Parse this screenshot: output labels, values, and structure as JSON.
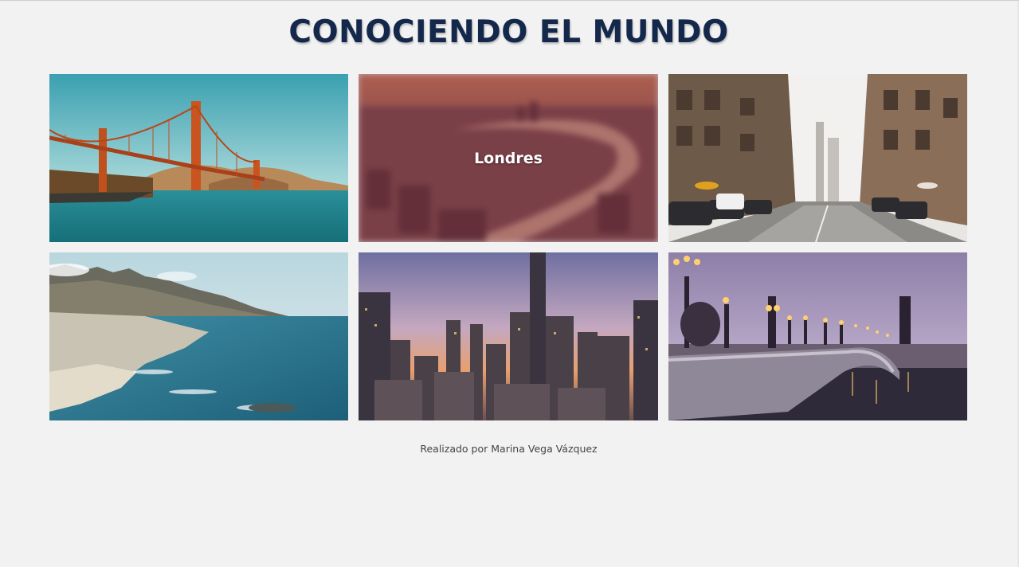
{
  "header": {
    "title": "CONOCIENDO EL MUNDO"
  },
  "gallery": {
    "tiles": [
      {
        "id": "san-francisco",
        "caption": ""
      },
      {
        "id": "londres",
        "caption": "Londres"
      },
      {
        "id": "nueva-york",
        "caption": ""
      },
      {
        "id": "ciudad-del-cabo",
        "caption": ""
      },
      {
        "id": "pekin",
        "caption": ""
      },
      {
        "id": "paris",
        "caption": ""
      }
    ],
    "hovered_caption": "Londres"
  },
  "footer": {
    "credit": "Realizado por Marina Vega Vázquez"
  },
  "colors": {
    "background": "#f2f2f2",
    "title": "#14284b",
    "overlay": "#782d3c"
  }
}
